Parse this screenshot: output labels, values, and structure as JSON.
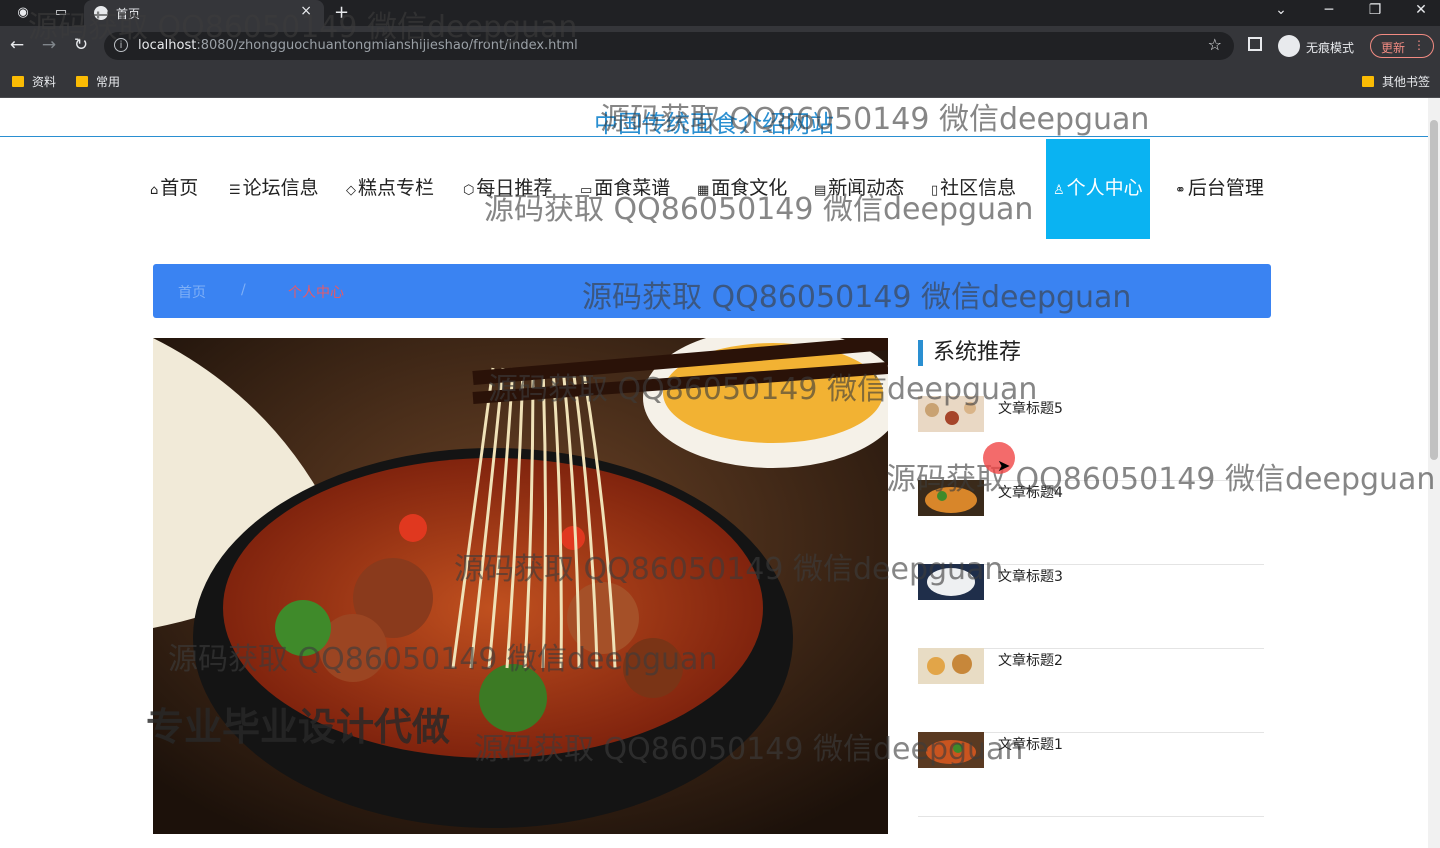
{
  "browser": {
    "tab_title": "首页",
    "tab_close": "×",
    "new_tab": "+",
    "url_host": "localhost",
    "url_rest": ":8080/zhongguochuantongmianshijieshao/front/index.html",
    "incognito_label": "无痕模式",
    "update_label": "更新",
    "bookmarks": [
      "资料",
      "常用"
    ],
    "other_bookmarks": "其他书签",
    "window_buttons": {
      "minimize": "─",
      "restore": "❐",
      "close": "✕"
    }
  },
  "site": {
    "title": "中国传统面食介绍网站",
    "nav": [
      {
        "icon": "home-icon",
        "glyph": "⌂",
        "label": "首页"
      },
      {
        "icon": "forum-icon",
        "glyph": "☰",
        "label": "论坛信息"
      },
      {
        "icon": "tag-icon",
        "glyph": "◇",
        "label": "糕点专栏"
      },
      {
        "icon": "cube-icon",
        "glyph": "⬡",
        "label": "每日推荐"
      },
      {
        "icon": "recipe-icon",
        "glyph": "▭",
        "label": "面食菜谱"
      },
      {
        "icon": "culture-icon",
        "glyph": "▦",
        "label": "面食文化"
      },
      {
        "icon": "news-icon",
        "glyph": "▤",
        "label": "新闻动态"
      },
      {
        "icon": "community-icon",
        "glyph": "▯",
        "label": "社区信息"
      },
      {
        "icon": "user-icon",
        "glyph": "♙",
        "label": "个人中心"
      },
      {
        "icon": "link-icon",
        "glyph": "⚭",
        "label": "后台管理"
      }
    ],
    "breadcrumb": {
      "home": "首页",
      "sep": "/",
      "current": "个人中心"
    },
    "sidebar_title": "系统推荐",
    "articles": [
      "文章标题5",
      "文章标题4",
      "文章标题3",
      "文章标题2",
      "文章标题1"
    ]
  },
  "watermarks": {
    "text": "源码获取 QQ86050149 微信deepguan",
    "big_text": "专业毕业设计代做"
  },
  "colors": {
    "accent": "#0ab3f2",
    "breadcrumb_bg": "#3a83f2",
    "title_blue": "#2a8fd1"
  }
}
